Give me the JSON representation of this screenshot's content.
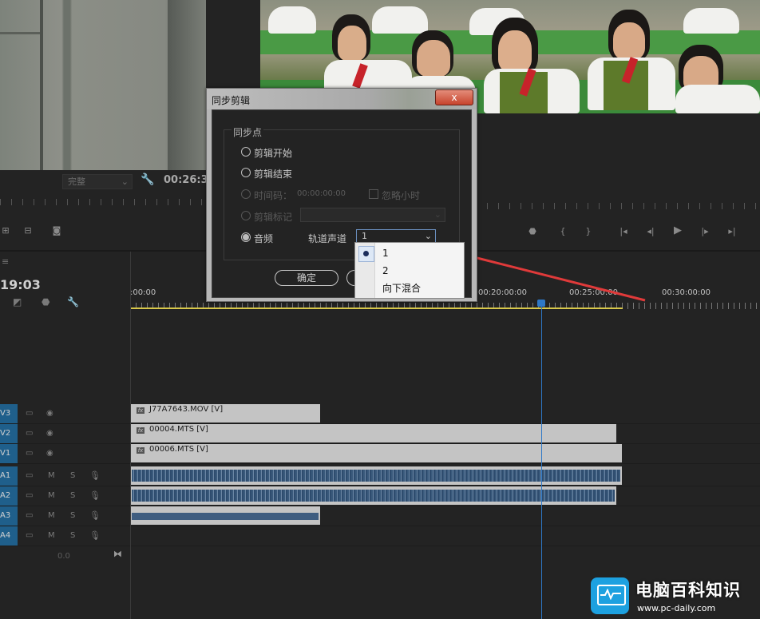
{
  "source_monitor": {
    "fit_value": "完整",
    "timecode": "00:26:3"
  },
  "timeline": {
    "timecode": "19:03",
    "ruler_labels": [
      ":00:00",
      "00:20:00:00",
      "00:25:00:00",
      "00:30:00:00"
    ],
    "volume": "0.0",
    "tracks": [
      {
        "id": "V3",
        "type": "video",
        "clips": [
          {
            "name": "J77A7643.MOV [V]"
          }
        ]
      },
      {
        "id": "V2",
        "type": "video",
        "clips": [
          {
            "name": "00004.MTS [V]"
          }
        ]
      },
      {
        "id": "V1",
        "type": "video",
        "clips": [
          {
            "name": "00006.MTS [V]"
          }
        ]
      },
      {
        "id": "A1",
        "type": "audio",
        "mute": "M",
        "solo": "S"
      },
      {
        "id": "A2",
        "type": "audio",
        "mute": "M",
        "solo": "S"
      },
      {
        "id": "A3",
        "type": "audio",
        "mute": "M",
        "solo": "S"
      },
      {
        "id": "A4",
        "type": "audio",
        "mute": "M",
        "solo": "S"
      }
    ]
  },
  "dialog": {
    "title": "同步剪辑",
    "close": "x",
    "group_label": "同步点",
    "options": {
      "clip_start": "剪辑开始",
      "clip_end": "剪辑结束",
      "timecode": "时间码：",
      "timecode_value": "00:00:00:00",
      "ignore_hours": "忽略小时",
      "clip_marker": "剪辑标记",
      "audio": "音频",
      "track_channel": "轨道声道",
      "track_channel_value": "1"
    },
    "ok": "确定",
    "selected": "audio"
  },
  "dropdown": {
    "items": [
      "1",
      "2",
      "向下混合"
    ],
    "selected_index": 0
  },
  "watermark": {
    "site_name": "电脑百科知识",
    "url": "www.pc-daily.com"
  },
  "colors": {
    "track_tag": "#1f5f8b",
    "playhead": "#2e78c7",
    "arrow": "#e03a3a",
    "work_area": "#d8c84a"
  }
}
